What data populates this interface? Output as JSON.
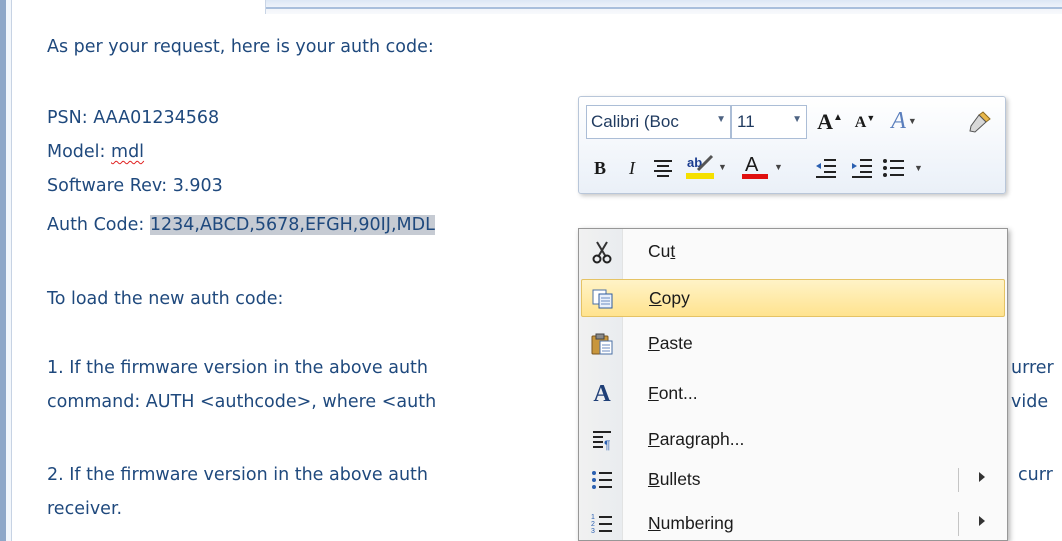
{
  "email": {
    "lines": [
      "As per your request, here is your auth code:",
      "PSN: AAA01234568",
      "Model: ",
      "mdl",
      "Software Rev: 3.903",
      "Auth Code: ",
      "1234,ABCD,5678,EFGH,90IJ,MDL",
      "To load the new auth code:",
      "1. If the firmware version in the above auth",
      "urrer",
      "command: AUTH <authcode>, where <auth",
      "vide",
      "2. If the firmware version in the above auth",
      "curr",
      "receiver."
    ]
  },
  "mini_toolbar": {
    "font_name": "Calibri (Boc",
    "font_size": "11",
    "icons": [
      "grow-font-icon",
      "shrink-font-icon",
      "styles-icon",
      "format-painter-icon",
      "bold-icon",
      "italic-icon",
      "center-align-icon",
      "highlight-icon",
      "font-color-icon",
      "decrease-indent-icon",
      "increase-indent-icon",
      "bullets-icon"
    ],
    "highlight_color": "#f5e000",
    "font_color": "#e01010"
  },
  "context_menu": {
    "items": [
      {
        "label": "Cut",
        "accel_before": "Cu",
        "accel": "t",
        "accel_after": "",
        "icon": "scissors-icon"
      },
      {
        "label": "Copy",
        "accel_before": "",
        "accel": "C",
        "accel_after": "opy",
        "icon": "copy-icon"
      },
      {
        "label": "Paste",
        "accel_before": "",
        "accel": "P",
        "accel_after": "aste",
        "icon": "paste-icon"
      },
      {
        "label": "Font...",
        "accel_before": "",
        "accel": "F",
        "accel_after": "ont...",
        "icon": "font-icon"
      },
      {
        "label": "Paragraph...",
        "accel_before": "",
        "accel": "P",
        "accel_after": "aragraph...",
        "icon": "paragraph-icon"
      },
      {
        "label": "Bullets",
        "accel_before": "",
        "accel": "B",
        "accel_after": "ullets",
        "icon": "bullets-icon"
      },
      {
        "label": "Numbering",
        "accel_before": "",
        "accel": "N",
        "accel_after": "umbering",
        "icon": "numbering-icon"
      }
    ],
    "highlighted": "Copy"
  },
  "colors": {
    "text": "#1f497d",
    "selection": "#c6cbd3",
    "menu_highlight": "#ffe38f"
  }
}
